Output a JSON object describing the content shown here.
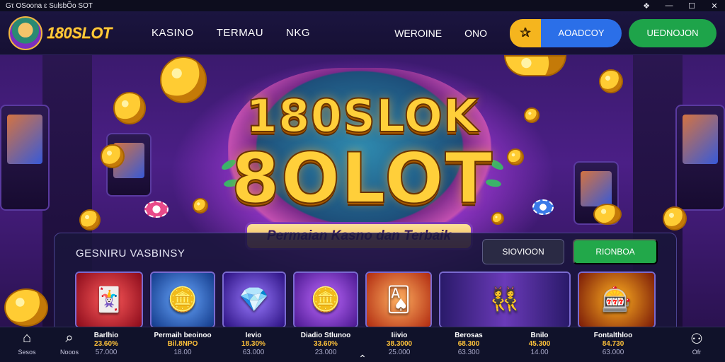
{
  "window": {
    "title": "Gτ  OSoona ε SulsbÕo SOT",
    "controls": [
      "❖",
      "—",
      "☐",
      "✕"
    ]
  },
  "nav": {
    "logo_text": "180SLOT",
    "links": [
      "KASINO",
      "TERMAU",
      "NKG"
    ],
    "right_links": [
      "WEROINE",
      "ONO"
    ],
    "icon_button_glyph": "✰",
    "blue_button": "AOADCOY",
    "green_button": "UEDNOJON"
  },
  "hero": {
    "line1": "180SLOK",
    "line2": "8OLOT",
    "tagline": "Permaian Kasno dan Terbaik"
  },
  "panel": {
    "title": "GESNIRU VASBINSY",
    "button_dark": "SIOVIOON",
    "button_green": "RIONBOA"
  },
  "games": [
    {
      "icon": "card-icon",
      "glyph": "🃏",
      "bg": "#c8202e"
    },
    {
      "icon": "coin-mascot-icon",
      "glyph": "🪙",
      "bg": "#1e6bd0"
    },
    {
      "icon": "blue-card-icon",
      "glyph": "💎",
      "bg": "#5a2fd0"
    },
    {
      "icon": "coin-stack-icon",
      "glyph": "🪙",
      "bg": "#7a28c8"
    },
    {
      "icon": "playing-cards-icon",
      "glyph": "🂡",
      "bg": "#e0502a"
    },
    {
      "icon": "dealers-icon",
      "glyph": "👯",
      "bg": "#3a2a8a"
    },
    {
      "icon": "logo-icon",
      "glyph": "🎰",
      "bg": "#9a2a10"
    }
  ],
  "bottom_nav": [
    {
      "icon": "home-icon",
      "glyph": "⌂",
      "label": "Sesos"
    },
    {
      "icon": "search-icon",
      "glyph": "⌕",
      "label": "Nooos"
    },
    {
      "icon": "profile-icon",
      "glyph": "⚇",
      "label": "Ofr"
    }
  ],
  "bottom_games": [
    {
      "name": "Barlhio",
      "value": "23.60%",
      "sub": "57.000"
    },
    {
      "name": "Permaih beoinoo",
      "value": "Bil.8NPO",
      "sub": "18.00"
    },
    {
      "name": "Ievio",
      "value": "18.30%",
      "sub": "63.000"
    },
    {
      "name": "Diadio Stlunoo",
      "value": "33.60%",
      "sub": "23.000"
    },
    {
      "name": "Iiivio",
      "value": "38.3000",
      "sub": "25.000"
    },
    {
      "name": "Berosas",
      "value": "68.300",
      "sub": "63.300"
    },
    {
      "name": "Bnilo",
      "value": "45.300",
      "sub": "14.00"
    },
    {
      "name": "Fontalthloo",
      "value": "84.730",
      "sub": "63.000"
    }
  ],
  "colors": {
    "brand_gold": "#ffc93a",
    "accent_blue": "#2b6fe8",
    "accent_green": "#1ea44a",
    "accent_orange": "#f5b51e"
  }
}
